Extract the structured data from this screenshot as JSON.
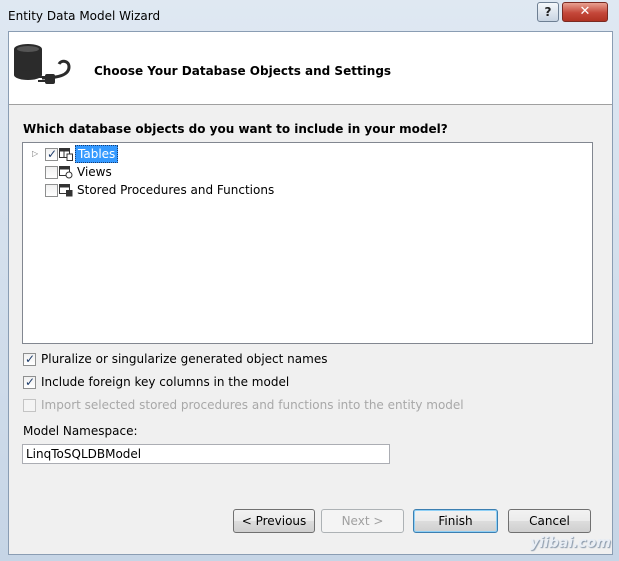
{
  "window": {
    "title": "Entity Data Model Wizard",
    "help_label": "?",
    "close_label": "✕"
  },
  "header": {
    "text": "Choose Your Database Objects and Settings",
    "icon": "database-plug-icon"
  },
  "question": "Which database objects do you want to include in your model?",
  "tree": {
    "items": [
      {
        "label": "Tables",
        "checked": true,
        "selected": true,
        "icon": "tables-icon"
      },
      {
        "label": "Views",
        "checked": false,
        "selected": false,
        "icon": "views-icon"
      },
      {
        "label": "Stored Procedures and Functions",
        "checked": false,
        "selected": false,
        "icon": "stored-procedures-icon"
      }
    ]
  },
  "options": [
    {
      "label": "Pluralize or singularize generated object names",
      "checked": true,
      "enabled": true
    },
    {
      "label": "Include foreign key columns in the model",
      "checked": true,
      "enabled": true
    },
    {
      "label": "Import selected stored procedures and functions into the entity model",
      "checked": false,
      "enabled": false
    }
  ],
  "namespace": {
    "label": "Model Namespace:",
    "value": "LinqToSQLDBModel"
  },
  "buttons": {
    "previous": "< Previous",
    "next": "Next >",
    "finish": "Finish",
    "cancel": "Cancel"
  },
  "watermark": "yiibai.com",
  "colors": {
    "selection": "#3399ff",
    "close": "#c4473a"
  }
}
